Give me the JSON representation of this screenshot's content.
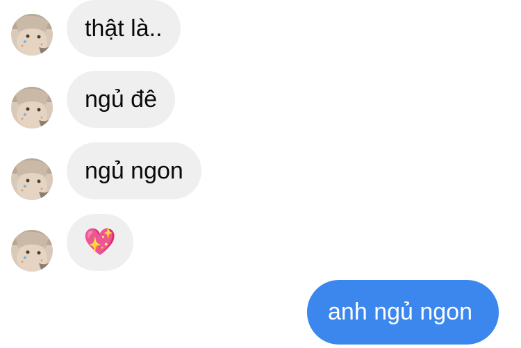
{
  "messages": [
    {
      "sender": "other",
      "text": "thật là.."
    },
    {
      "sender": "other",
      "text": "ngủ đê"
    },
    {
      "sender": "other",
      "text": "ngủ ngon"
    },
    {
      "sender": "other",
      "text": "💖",
      "is_emoji": true
    },
    {
      "sender": "me",
      "text": "anh ngủ ngon"
    }
  ],
  "colors": {
    "incoming_bubble": "#efefef",
    "outgoing_bubble": "#3b87ed",
    "incoming_text": "#0a0a0a",
    "outgoing_text": "#ffffff"
  },
  "icons": {
    "avatar": "contact-avatar-photo"
  }
}
